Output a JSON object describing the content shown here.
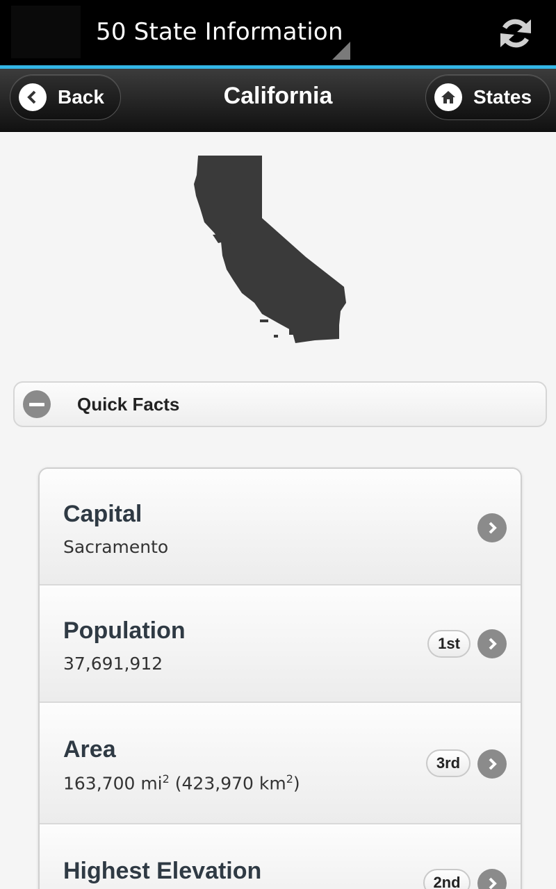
{
  "action_bar": {
    "app_title": "50 State Information",
    "refresh_icon": "refresh-icon",
    "accent_color": "#33b5e5"
  },
  "header": {
    "back_label": "Back",
    "title": "California",
    "states_label": "States",
    "back_icon": "chevron-left-icon",
    "home_icon": "home-icon"
  },
  "state_image": "california-silhouette",
  "quick_facts": {
    "label": "Quick Facts",
    "icon": "minus-icon"
  },
  "facts": [
    {
      "title": "Capital",
      "value": "Sacramento",
      "rank": ""
    },
    {
      "title": "Population",
      "value": "37,691,912",
      "rank": "1st"
    },
    {
      "title": "Area",
      "value_parts": [
        "163,700 mi",
        "2",
        " (423,970 km",
        "2",
        ")"
      ],
      "rank": "3rd"
    },
    {
      "title": "Highest Elevation",
      "value": "",
      "rank": "2nd"
    }
  ]
}
